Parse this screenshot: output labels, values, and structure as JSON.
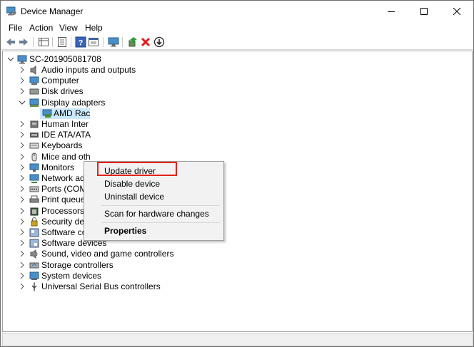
{
  "window": {
    "title": "Device Manager",
    "controls": [
      "minimize",
      "maximize",
      "close"
    ]
  },
  "menu": [
    "File",
    "Action",
    "View",
    "Help"
  ],
  "toolbar": [
    "back-arrow-icon",
    "forward-arrow-icon",
    "properties-grid-icon",
    "document-icon",
    "help-icon",
    "window-icon",
    "monitor-icon",
    "update-driver-icon",
    "uninstall-x-icon",
    "download-circle-icon"
  ],
  "tree": {
    "root": "SC-201905081708",
    "items": [
      {
        "label": "Audio inputs and outputs",
        "icon": "speaker-icon"
      },
      {
        "label": "Computer",
        "icon": "computer-icon"
      },
      {
        "label": "Disk drives",
        "icon": "disk-icon"
      },
      {
        "label": "Display adapters",
        "icon": "display-adapter-icon",
        "expanded": true
      },
      {
        "label": "AMD Rac",
        "icon": "adapter-card-icon",
        "child": true,
        "selected": true
      },
      {
        "label": "Human Inter",
        "icon": "human-interface-icon"
      },
      {
        "label": "IDE ATA/ATA",
        "icon": "ide-icon"
      },
      {
        "label": "Keyboards",
        "icon": "keyboard-icon"
      },
      {
        "label": "Mice and oth",
        "icon": "mouse-icon"
      },
      {
        "label": "Monitors",
        "icon": "monitor-icon"
      },
      {
        "label": "Network ada",
        "icon": "network-icon"
      },
      {
        "label": "Ports (COM & LPT)",
        "icon": "port-icon"
      },
      {
        "label": "Print queues",
        "icon": "printer-icon"
      },
      {
        "label": "Processors",
        "icon": "processor-icon"
      },
      {
        "label": "Security devices",
        "icon": "security-icon"
      },
      {
        "label": "Software components",
        "icon": "software-components-icon"
      },
      {
        "label": "Software devices",
        "icon": "software-devices-icon"
      },
      {
        "label": "Sound, video and game controllers",
        "icon": "sound-icon"
      },
      {
        "label": "Storage controllers",
        "icon": "storage-icon"
      },
      {
        "label": "System devices",
        "icon": "system-devices-icon"
      },
      {
        "label": "Universal Serial Bus controllers",
        "icon": "usb-icon"
      }
    ]
  },
  "context_menu": {
    "items": [
      {
        "label": "Update driver",
        "highlighted": true
      },
      {
        "label": "Disable device"
      },
      {
        "label": "Uninstall device"
      },
      {
        "label": "Scan for hardware changes"
      },
      {
        "label": "Properties",
        "bold": true
      }
    ],
    "highlight_color": "#e2231a"
  },
  "colors": {
    "selection": "#cce8ff",
    "accent": "#0078d7"
  }
}
